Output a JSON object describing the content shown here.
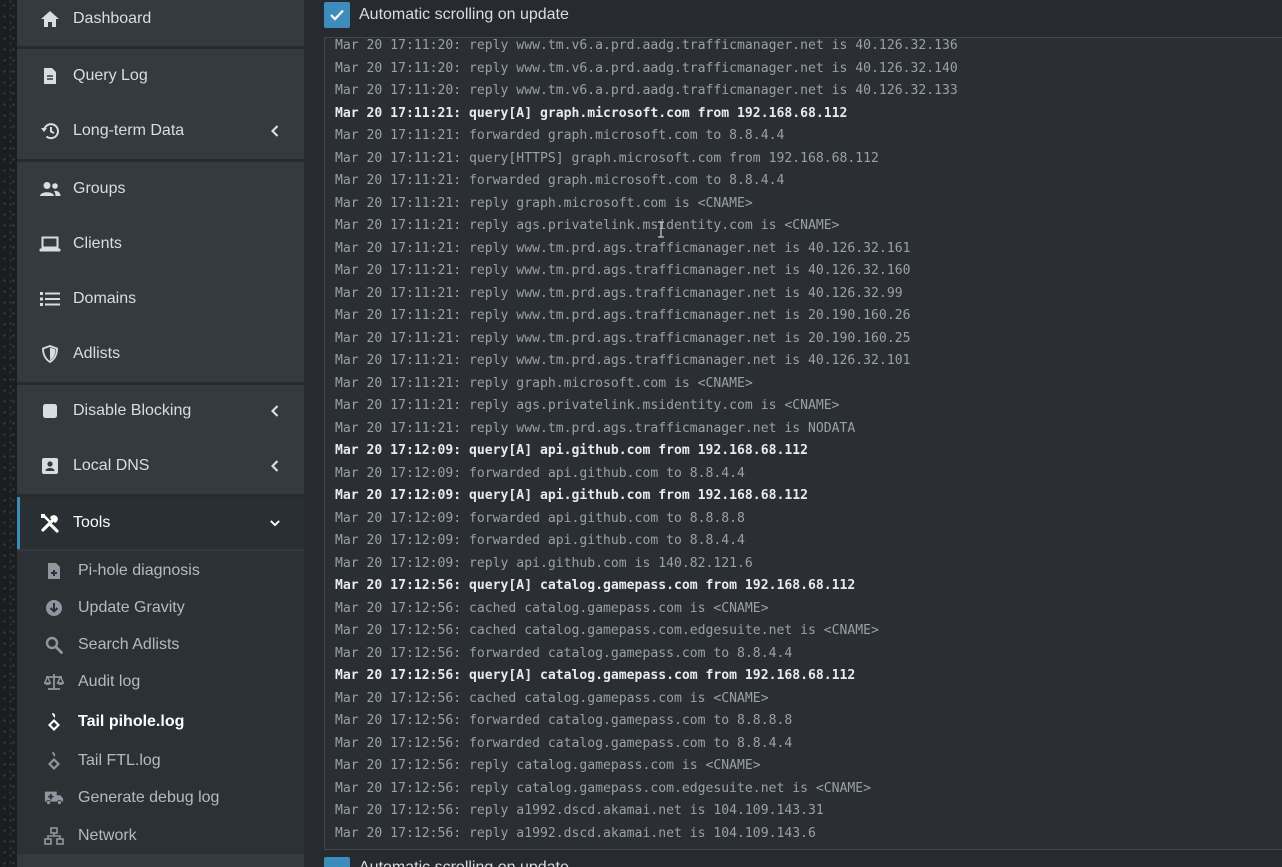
{
  "sidebar": {
    "items": [
      {
        "label": "Dashboard",
        "icon": "home-icon"
      },
      {
        "label": "Query Log",
        "icon": "file-icon"
      },
      {
        "label": "Long-term Data",
        "icon": "history-icon"
      },
      {
        "label": "Groups",
        "icon": "users-icon"
      },
      {
        "label": "Clients",
        "icon": "laptop-icon"
      },
      {
        "label": "Domains",
        "icon": "list-icon"
      },
      {
        "label": "Adlists",
        "icon": "shield-icon"
      },
      {
        "label": "Disable Blocking",
        "icon": "stop-icon"
      },
      {
        "label": "Local DNS",
        "icon": "address-card-icon"
      },
      {
        "label": "Tools",
        "icon": "tools-icon"
      }
    ],
    "tools_submenu": [
      {
        "label": "Pi-hole diagnosis",
        "icon": "file-medical-icon"
      },
      {
        "label": "Update Gravity",
        "icon": "arrow-circle-down-icon"
      },
      {
        "label": "Search Adlists",
        "icon": "search-icon"
      },
      {
        "label": "Audit log",
        "icon": "balance-scale-icon"
      },
      {
        "label": "Tail pihole.log",
        "icon": "pihole-icon"
      },
      {
        "label": "Tail FTL.log",
        "icon": "pihole-icon"
      },
      {
        "label": "Generate debug log",
        "icon": "ambulance-icon"
      },
      {
        "label": "Network",
        "icon": "network-icon"
      }
    ]
  },
  "autoscroll": {
    "label": "Automatic scrolling on update",
    "checked": true
  },
  "colors": {
    "accent": "#3c8dbc",
    "sidebar_bg": "#343a40",
    "content_bg": "#272b30"
  },
  "log_lines": [
    {
      "text": "Mar 20 17:11:20: reply www.tm.v6.a.prd.aadg.trafficmanager.net is 40.126.32.136",
      "bold": false
    },
    {
      "text": "Mar 20 17:11:20: reply www.tm.v6.a.prd.aadg.trafficmanager.net is 40.126.32.140",
      "bold": false
    },
    {
      "text": "Mar 20 17:11:20: reply www.tm.v6.a.prd.aadg.trafficmanager.net is 40.126.32.133",
      "bold": false
    },
    {
      "text": "Mar 20 17:11:21: query[A] graph.microsoft.com from 192.168.68.112",
      "bold": true
    },
    {
      "text": "Mar 20 17:11:21: forwarded graph.microsoft.com to 8.8.4.4",
      "bold": false
    },
    {
      "text": "Mar 20 17:11:21: query[HTTPS] graph.microsoft.com from 192.168.68.112",
      "bold": false
    },
    {
      "text": "Mar 20 17:11:21: forwarded graph.microsoft.com to 8.8.4.4",
      "bold": false
    },
    {
      "text": "Mar 20 17:11:21: reply graph.microsoft.com is <CNAME>",
      "bold": false
    },
    {
      "text": "Mar 20 17:11:21: reply ags.privatelink.msidentity.com is <CNAME>",
      "bold": false
    },
    {
      "text": "Mar 20 17:11:21: reply www.tm.prd.ags.trafficmanager.net is 40.126.32.161",
      "bold": false
    },
    {
      "text": "Mar 20 17:11:21: reply www.tm.prd.ags.trafficmanager.net is 40.126.32.160",
      "bold": false
    },
    {
      "text": "Mar 20 17:11:21: reply www.tm.prd.ags.trafficmanager.net is 40.126.32.99",
      "bold": false
    },
    {
      "text": "Mar 20 17:11:21: reply www.tm.prd.ags.trafficmanager.net is 20.190.160.26",
      "bold": false
    },
    {
      "text": "Mar 20 17:11:21: reply www.tm.prd.ags.trafficmanager.net is 20.190.160.25",
      "bold": false
    },
    {
      "text": "Mar 20 17:11:21: reply www.tm.prd.ags.trafficmanager.net is 40.126.32.101",
      "bold": false
    },
    {
      "text": "Mar 20 17:11:21: reply graph.microsoft.com is <CNAME>",
      "bold": false
    },
    {
      "text": "Mar 20 17:11:21: reply ags.privatelink.msidentity.com is <CNAME>",
      "bold": false
    },
    {
      "text": "Mar 20 17:11:21: reply www.tm.prd.ags.trafficmanager.net is NODATA",
      "bold": false
    },
    {
      "text": "Mar 20 17:12:09: query[A] api.github.com from 192.168.68.112",
      "bold": true
    },
    {
      "text": "Mar 20 17:12:09: forwarded api.github.com to 8.8.4.4",
      "bold": false
    },
    {
      "text": "Mar 20 17:12:09: query[A] api.github.com from 192.168.68.112",
      "bold": true
    },
    {
      "text": "Mar 20 17:12:09: forwarded api.github.com to 8.8.8.8",
      "bold": false
    },
    {
      "text": "Mar 20 17:12:09: forwarded api.github.com to 8.8.4.4",
      "bold": false
    },
    {
      "text": "Mar 20 17:12:09: reply api.github.com is 140.82.121.6",
      "bold": false
    },
    {
      "text": "Mar 20 17:12:56: query[A] catalog.gamepass.com from 192.168.68.112",
      "bold": true
    },
    {
      "text": "Mar 20 17:12:56: cached catalog.gamepass.com is <CNAME>",
      "bold": false
    },
    {
      "text": "Mar 20 17:12:56: cached catalog.gamepass.com.edgesuite.net is <CNAME>",
      "bold": false
    },
    {
      "text": "Mar 20 17:12:56: forwarded catalog.gamepass.com to 8.8.4.4",
      "bold": false
    },
    {
      "text": "Mar 20 17:12:56: query[A] catalog.gamepass.com from 192.168.68.112",
      "bold": true
    },
    {
      "text": "Mar 20 17:12:56: cached catalog.gamepass.com is <CNAME>",
      "bold": false
    },
    {
      "text": "Mar 20 17:12:56: forwarded catalog.gamepass.com to 8.8.8.8",
      "bold": false
    },
    {
      "text": "Mar 20 17:12:56: forwarded catalog.gamepass.com to 8.8.4.4",
      "bold": false
    },
    {
      "text": "Mar 20 17:12:56: reply catalog.gamepass.com is <CNAME>",
      "bold": false
    },
    {
      "text": "Mar 20 17:12:56: reply catalog.gamepass.com.edgesuite.net is <CNAME>",
      "bold": false
    },
    {
      "text": "Mar 20 17:12:56: reply a1992.dscd.akamai.net is 104.109.143.31",
      "bold": false
    },
    {
      "text": "Mar 20 17:12:56: reply a1992.dscd.akamai.net is 104.109.143.6",
      "bold": false
    }
  ]
}
